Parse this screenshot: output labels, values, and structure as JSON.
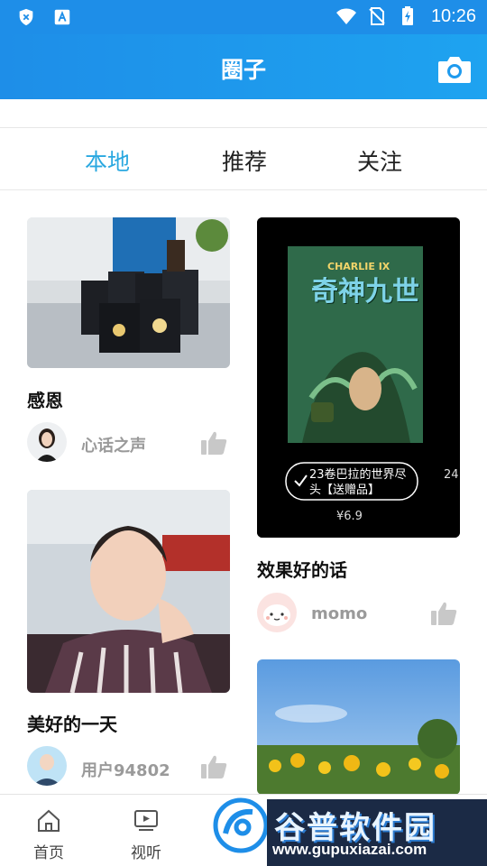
{
  "status_bar": {
    "time": "10:26"
  },
  "app_bar": {
    "title": "圈子",
    "camera_icon": "camera-icon"
  },
  "tabs": [
    {
      "label": "本地",
      "active": true
    },
    {
      "label": "推荐",
      "active": false
    },
    {
      "label": "关注",
      "active": false
    }
  ],
  "posts": {
    "left": [
      {
        "title": "感恩",
        "user": "心话之声"
      },
      {
        "title": "美好的一天",
        "user": "用户94802"
      }
    ],
    "right": [
      {
        "title": "效果好的话",
        "user": "momo",
        "image_text": {
          "book_name": "奇神九世",
          "brand": "CHARLIE IX",
          "button": "23卷巴拉的世界尽头【送赠品】",
          "price": "¥6.9",
          "next_item": "24"
        }
      },
      {
        "title": "",
        "user": ""
      }
    ]
  },
  "bottom_nav": [
    {
      "label": "首页",
      "icon": "home-icon"
    },
    {
      "label": "视听",
      "icon": "video-icon"
    }
  ],
  "watermark": {
    "title": "谷普软件园",
    "url": "www.gupuxiazai.com"
  },
  "colors": {
    "primary": "#1E8EE8",
    "active_tab": "#2AA8E0"
  }
}
